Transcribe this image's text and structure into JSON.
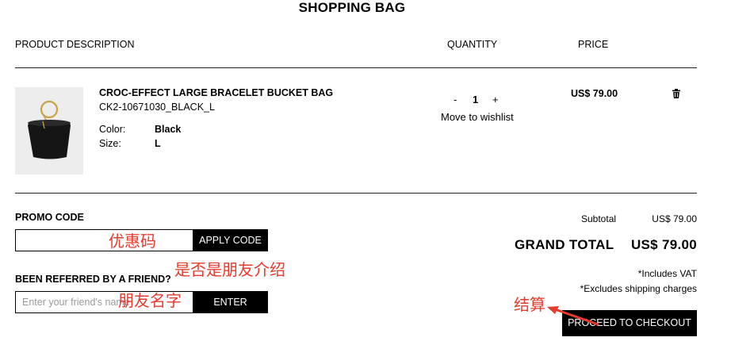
{
  "page": {
    "title": "SHOPPING BAG"
  },
  "columns": {
    "product_description": "PRODUCT DESCRIPTION",
    "quantity": "QUANTITY",
    "price": "PRICE"
  },
  "item": {
    "name": "CROC-EFFECT LARGE BRACELET BUCKET BAG",
    "sku": "CK2-10671030_BLACK_L",
    "color_label": "Color:",
    "color_value": "Black",
    "size_label": "Size:",
    "size_value": "L",
    "qty_minus": "-",
    "qty_value": "1",
    "qty_plus": "+",
    "move_to_wishlist": "Move to wishlist",
    "price": "US$ 79.00",
    "image_icon": "bucket-bag-image",
    "remove_icon": "trash-icon"
  },
  "promo": {
    "label": "PROMO CODE",
    "input_value": "",
    "apply_button": "APPLY CODE"
  },
  "referral": {
    "label": "BEEN REFERRED BY A FRIEND?",
    "placeholder": "Enter your friend's name",
    "enter_button": "ENTER"
  },
  "summary": {
    "subtotal_label": "Subtotal",
    "subtotal_value": "US$ 79.00",
    "grand_total_label": "GRAND TOTAL",
    "grand_total_value": "US$ 79.00",
    "vat_note": "*Includes VAT",
    "shipping_note": "*Excludes shipping charges",
    "checkout_button": "PROCEED TO CHECKOUT"
  },
  "annotations": {
    "promo_code": "优惠码",
    "referred_by_friend": "是否是朋友介绍",
    "friend_name": "朋友名字",
    "checkout": "结算",
    "color": "#e53b2c"
  }
}
